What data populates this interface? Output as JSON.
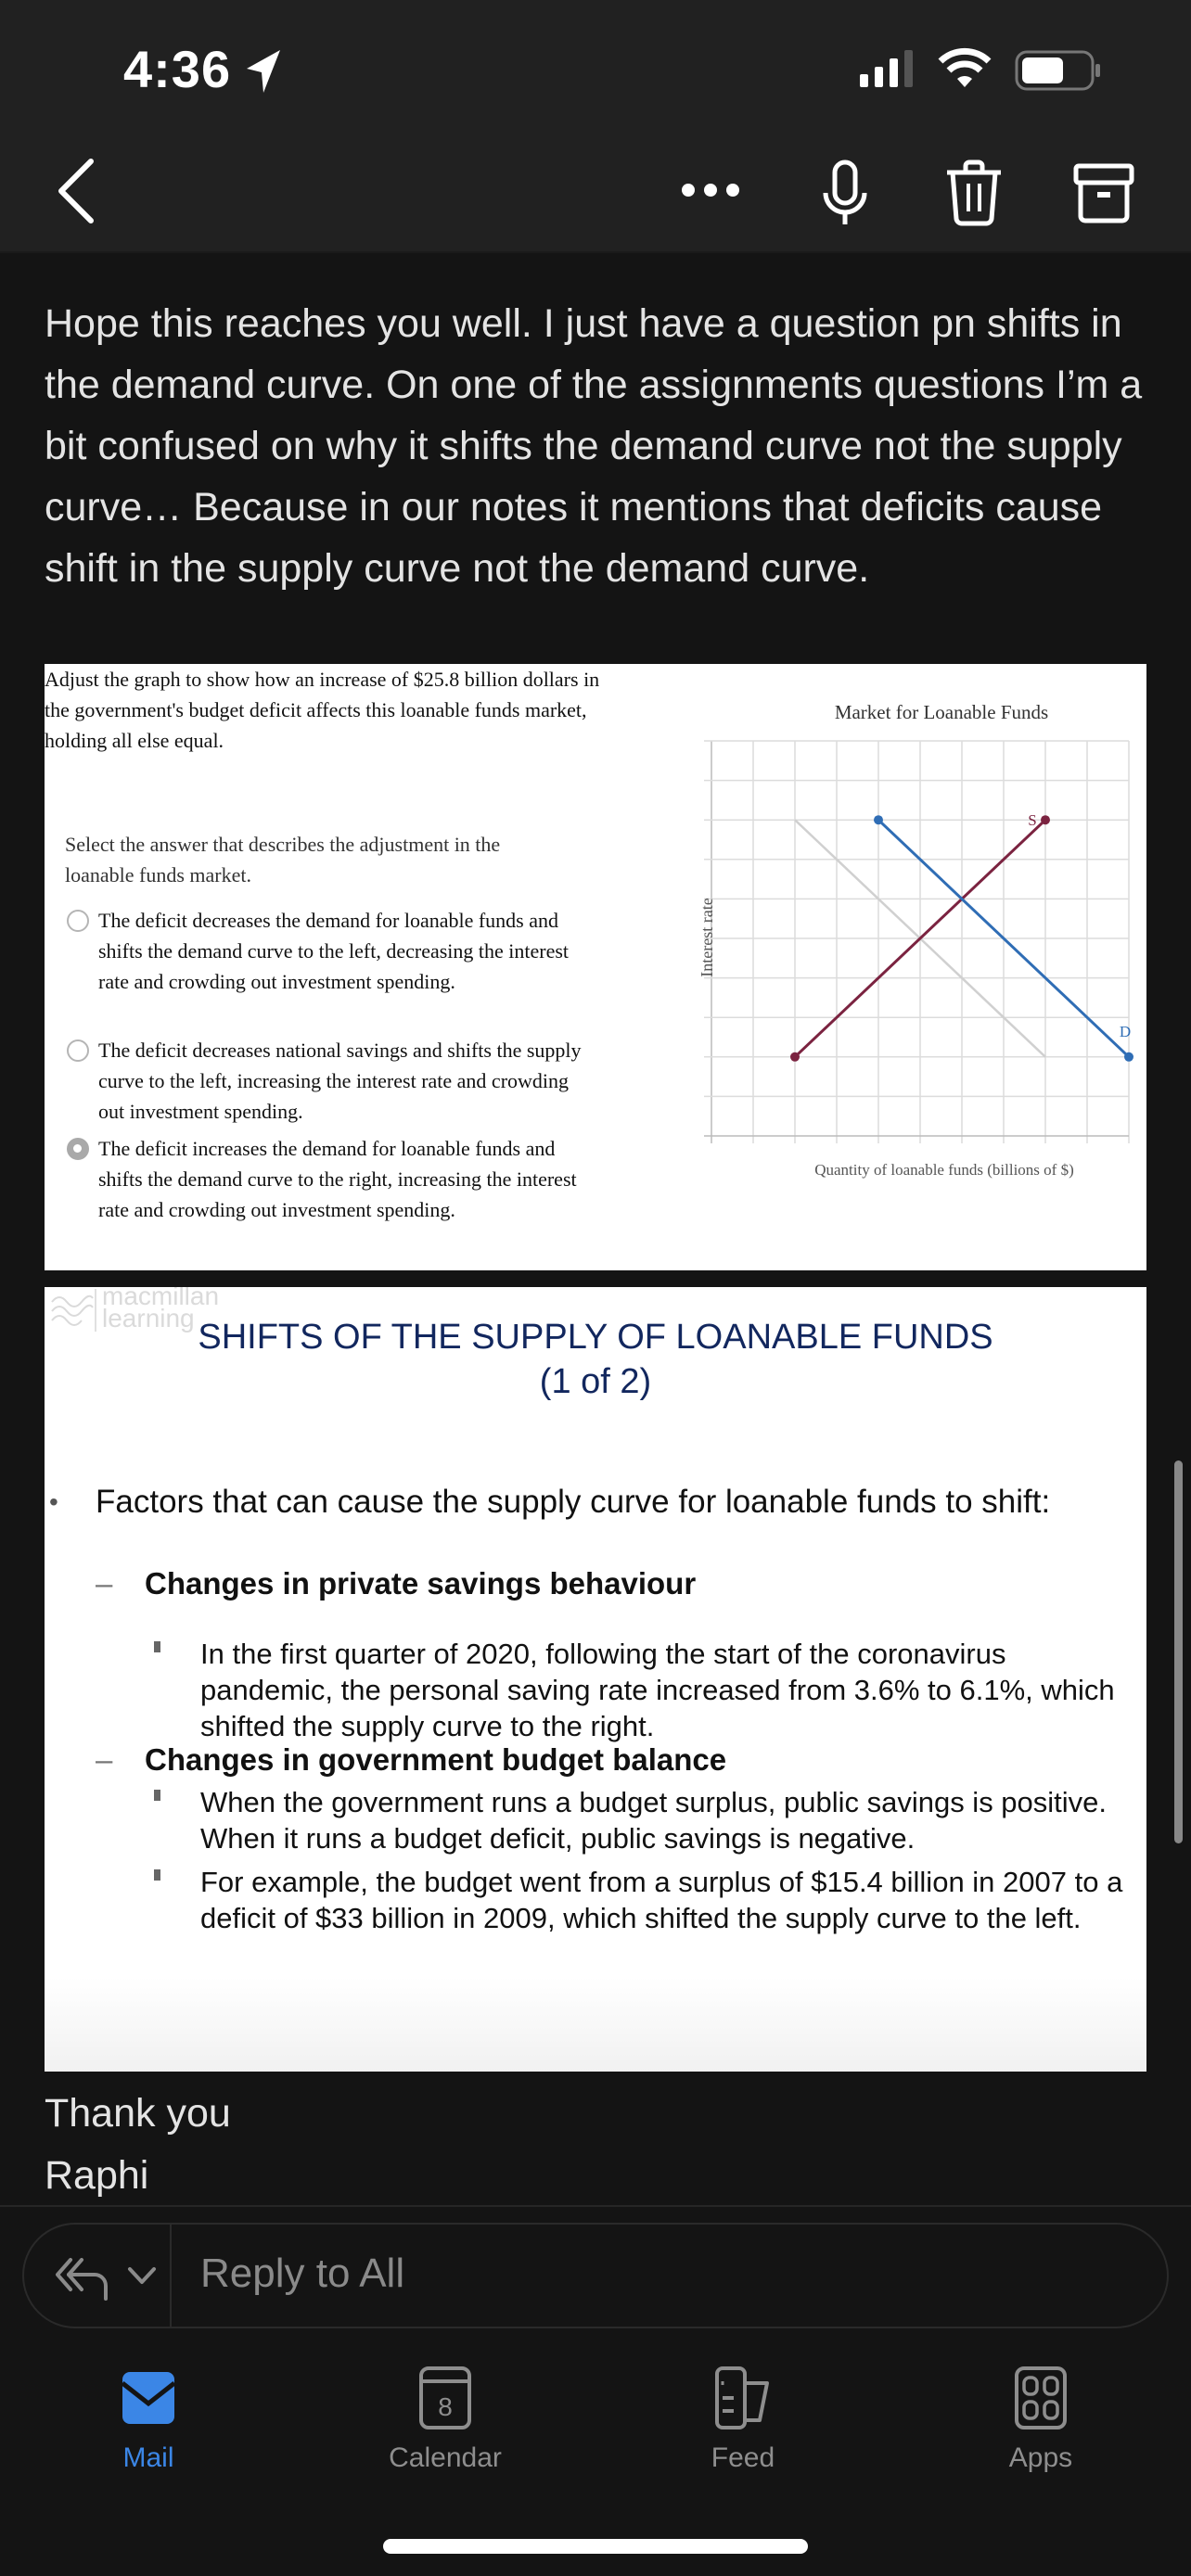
{
  "status_bar": {
    "time": "4:36",
    "icons": [
      "location-arrow-icon",
      "cellular-signal-icon",
      "wifi-icon",
      "battery-icon"
    ]
  },
  "toolbar": {
    "back": "chevron-left-icon",
    "more": "more-icon",
    "mic": "microphone-icon",
    "trash": "trash-icon",
    "archive": "archive-icon"
  },
  "email": {
    "body": "Hope this reaches you well. I just have a question pn shifts in the demand curve. On one of the assignments questions I’m a bit confused on why it shifts the demand curve not the supply curve… Because in our notes it mentions that deficits cause shift in the supply curve not the demand curve.",
    "closing": "Thank you",
    "signature": "Raphi"
  },
  "question": {
    "prompt": "Adjust the graph to show how an increase of $25.8 billion dollars in the government's budget deficit affects this loanable funds market, holding all else equal.",
    "select_label": "Select the answer that describes the adjustment in the loanable funds market.",
    "options": [
      {
        "text": "The deficit decreases the demand for loanable funds and shifts the demand curve to the left, decreasing the interest rate and crowding out investment spending.",
        "selected": false
      },
      {
        "text": "The deficit decreases national savings and shifts the supply curve to the left, increasing the interest rate and crowding out investment spending.",
        "selected": false
      },
      {
        "text": "The deficit increases the demand for loanable funds and shifts the demand curve to the right, increasing the interest rate and crowding out investment spending.",
        "selected": true
      }
    ]
  },
  "chart_data": {
    "type": "line",
    "title": "Market for Loanable Funds",
    "xlabel": "Quantity of loanable funds (billions of $)",
    "ylabel": "Interest rate",
    "xlim": [
      0,
      10
    ],
    "ylim": [
      0,
      10
    ],
    "grid": true,
    "series": [
      {
        "name": "S",
        "color": "#7b2340",
        "points": [
          [
            2,
            2
          ],
          [
            8,
            8
          ]
        ],
        "label_at": "top"
      },
      {
        "name": "D",
        "color": "#2f6db5",
        "points": [
          [
            4,
            8
          ],
          [
            10,
            2
          ]
        ],
        "label_at": "bottom"
      },
      {
        "name": "original demand",
        "color": "#d0d0d0",
        "points": [
          [
            2,
            8
          ],
          [
            8,
            2
          ]
        ],
        "label_at": null
      }
    ]
  },
  "slide": {
    "logo": [
      "macmillan",
      "learning"
    ],
    "title_line1": "SHIFTS OF THE SUPPLY OF LOANABLE FUNDS",
    "title_line2": "(1 of 2)",
    "bullet": "Factors that can cause the supply curve for loanable funds to shift:",
    "sub1": "Changes in private savings behaviour",
    "sub1_points": [
      "In the first quarter of 2020, following the start of the coronavirus pandemic, the personal saving rate increased from 3.6% to 6.1%, which shifted the supply curve to the right."
    ],
    "sub2": "Changes in government budget balance",
    "sub2_points": [
      "When the government runs a budget surplus, public savings is positive. When it runs a budget deficit, public savings is negative.",
      "For example, the budget went from a surplus of $15.4 billion in 2007 to a deficit of $33 billion in 2009, which shifted the supply curve to the left."
    ],
    "dash": "–"
  },
  "reply": {
    "label": "Reply to All",
    "icon": "reply-all-icon"
  },
  "tabs": [
    {
      "label": "Mail",
      "icon": "mail-icon",
      "active": true
    },
    {
      "label": "Calendar",
      "icon": "calendar-icon",
      "badge": "8",
      "active": false
    },
    {
      "label": "Feed",
      "icon": "feed-icon",
      "active": false
    },
    {
      "label": "Apps",
      "icon": "apps-icon",
      "active": false
    }
  ],
  "colors": {
    "accent": "#3b86e6",
    "slide_title": "#12275e",
    "supply": "#7b2340",
    "demand": "#2f6db5"
  }
}
